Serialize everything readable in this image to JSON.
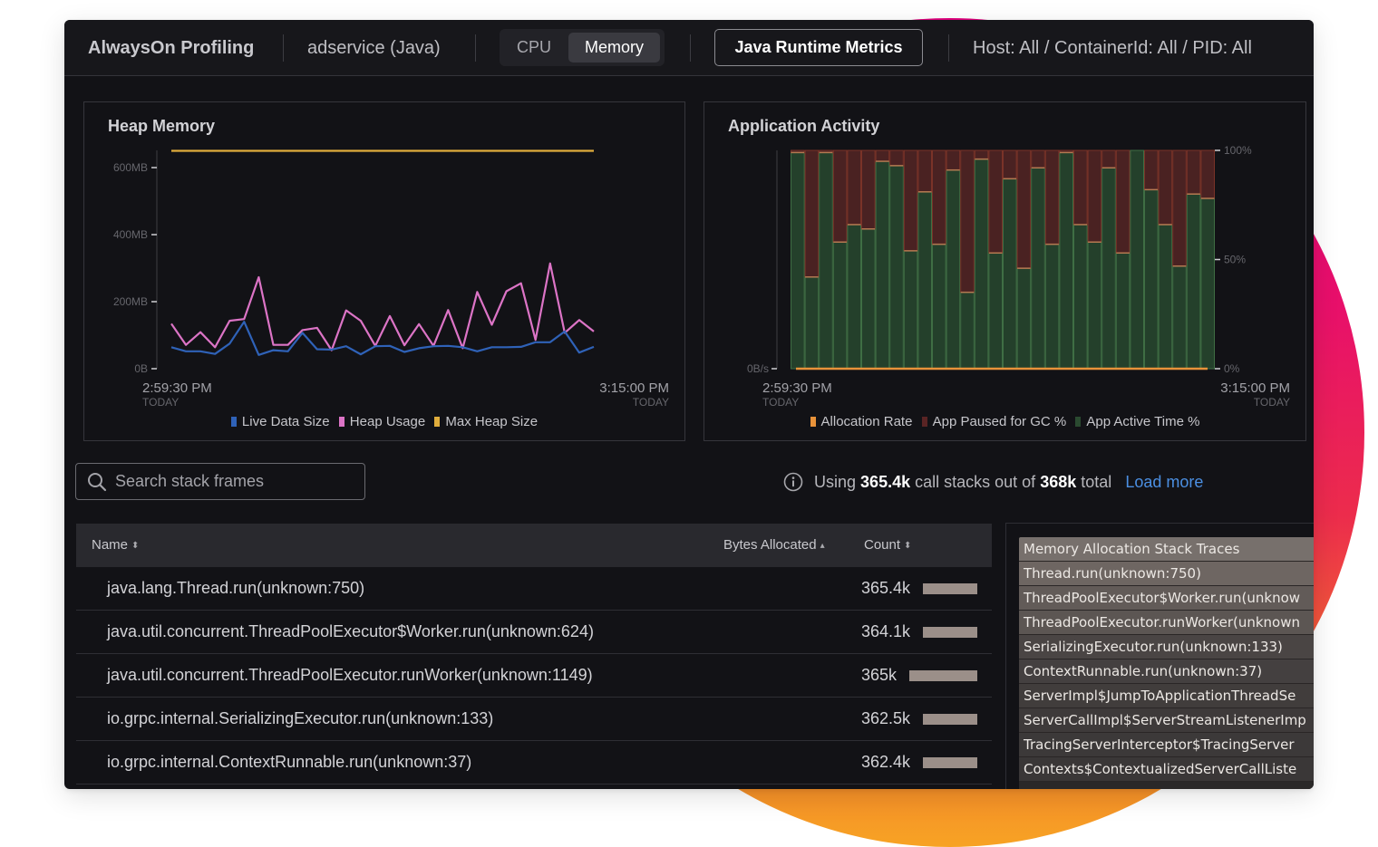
{
  "header": {
    "app_title": "AlwaysOn Profiling",
    "service": "adservice (Java)",
    "tabs": [
      {
        "label": "CPU",
        "active": false
      },
      {
        "label": "Memory",
        "active": true
      }
    ],
    "runtime_button": "Java Runtime Metrics",
    "filters": "Host: All / ContainerId: All / PID: All"
  },
  "heap_panel": {
    "title": "Heap Memory",
    "x_start": "2:59:30 PM",
    "x_start_sub": "TODAY",
    "x_end": "3:15:00 PM",
    "x_end_sub": "TODAY",
    "legend": [
      {
        "label": "Live Data Size",
        "color": "#2f62b8"
      },
      {
        "label": "Heap Usage",
        "color": "#dc74c6"
      },
      {
        "label": "Max Heap Size",
        "color": "#e0ad3c"
      }
    ]
  },
  "activity_panel": {
    "title": "Application Activity",
    "x_start": "2:59:30 PM",
    "x_start_sub": "TODAY",
    "x_end": "3:15:00 PM",
    "x_end_sub": "TODAY",
    "legend": [
      {
        "label": "Allocation Rate",
        "color": "#e8923a"
      },
      {
        "label": "App Paused for GC %",
        "color": "#5a2424"
      },
      {
        "label": "App Active Time %",
        "color": "#2a4a30"
      }
    ]
  },
  "chart_data": [
    {
      "type": "line",
      "title": "Heap Memory",
      "xlabel": "",
      "ylabel": "",
      "x_range": [
        "2:59:30 PM",
        "3:15:00 PM"
      ],
      "ylim": [
        0,
        650
      ],
      "y_unit": "MB",
      "yticks": [
        {
          "value": 0,
          "label": "0B"
        },
        {
          "value": 200,
          "label": "200MB"
        },
        {
          "value": 400,
          "label": "400MB"
        },
        {
          "value": 600,
          "label": "600MB"
        }
      ],
      "grid": false,
      "legend_position": "bottom",
      "series": [
        {
          "name": "Live Data Size",
          "color": "#2f62b8",
          "values": [
            64,
            52,
            52,
            44,
            75,
            140,
            41,
            55,
            52,
            107,
            58,
            57,
            67,
            43,
            67,
            68,
            50,
            61,
            67,
            68,
            64,
            52,
            64,
            64,
            65,
            79,
            79,
            111,
            48,
            65
          ]
        },
        {
          "name": "Heap Usage",
          "color": "#dc74c6",
          "values": [
            134,
            71,
            109,
            64,
            143,
            148,
            273,
            71,
            71,
            115,
            122,
            55,
            174,
            143,
            68,
            157,
            70,
            133,
            68,
            175,
            61,
            229,
            131,
            231,
            255,
            86,
            314,
            107,
            145,
            111
          ]
        },
        {
          "name": "Max Heap Size",
          "color": "#e0ad3c",
          "values": [
            650,
            650,
            650,
            650,
            650,
            650,
            650,
            650,
            650,
            650,
            650,
            650,
            650,
            650,
            650,
            650,
            650,
            650,
            650,
            650,
            650,
            650,
            650,
            650,
            650,
            650,
            650,
            650,
            650,
            650
          ]
        }
      ]
    },
    {
      "type": "bar",
      "stacked": true,
      "title": "Application Activity",
      "x_range": [
        "2:59:30 PM",
        "3:15:00 PM"
      ],
      "left_axis": {
        "ticks": [
          {
            "value": 0,
            "label": "0B/s"
          }
        ]
      },
      "right_axis": {
        "ylim": [
          0,
          100
        ],
        "ticks": [
          {
            "value": 0,
            "label": "0%"
          },
          {
            "value": 50,
            "label": "50%"
          },
          {
            "value": 100,
            "label": "100%"
          }
        ]
      },
      "grid": false,
      "legend_position": "bottom",
      "series": [
        {
          "name": "App Active Time %",
          "color": "#24402b",
          "values": [
            99,
            42,
            99,
            58,
            66,
            64,
            95,
            93,
            54,
            81,
            57,
            91,
            35,
            96,
            53,
            87,
            46,
            92,
            57,
            99,
            66,
            58,
            92,
            53,
            100,
            82,
            66,
            47,
            80,
            78
          ]
        },
        {
          "name": "App Paused for GC %",
          "color": "#4a2222",
          "values": [
            1,
            58,
            1,
            42,
            34,
            36,
            5,
            7,
            46,
            19,
            43,
            9,
            65,
            4,
            47,
            13,
            54,
            8,
            43,
            1,
            34,
            42,
            8,
            47,
            0,
            18,
            34,
            53,
            20,
            22
          ]
        },
        {
          "name": "Allocation Rate",
          "color": "#e8923a",
          "type": "line",
          "values": [
            0,
            0,
            0,
            0,
            0,
            0,
            0,
            0,
            0,
            0,
            0,
            0,
            0,
            0,
            0,
            0,
            0,
            0,
            0,
            0,
            0,
            0,
            0,
            0,
            0,
            0,
            0,
            0,
            0,
            0
          ]
        }
      ]
    }
  ],
  "search": {
    "placeholder": "Search stack frames",
    "value": ""
  },
  "info": {
    "prefix": "Using",
    "used": "365.4k",
    "middle": "call stacks out of",
    "total": "368k",
    "suffix": "total",
    "load_more": "Load more"
  },
  "table": {
    "columns": [
      {
        "label": "Name",
        "sort": "both"
      },
      {
        "label": "Bytes Allocated",
        "sort": "asc"
      },
      {
        "label": "Count",
        "sort": "both"
      }
    ],
    "rows": [
      {
        "name": "java.lang.Thread.run(unknown:750)",
        "count": "365.4k"
      },
      {
        "name": "java.util.concurrent.ThreadPoolExecutor$Worker.run(unknown:624)",
        "count": "364.1k"
      },
      {
        "name": "java.util.concurrent.ThreadPoolExecutor.runWorker(unknown:1149)",
        "count": "365k"
      },
      {
        "name": "io.grpc.internal.SerializingExecutor.run(unknown:133)",
        "count": "362.5k"
      },
      {
        "name": "io.grpc.internal.ContextRunnable.run(unknown:37)",
        "count": "362.4k"
      }
    ]
  },
  "stack_traces": {
    "items": [
      {
        "label": "Memory Allocation Stack Traces",
        "color": "#77706c"
      },
      {
        "label": "Thread.run(unknown:750)",
        "color": "#6e6662"
      },
      {
        "label": "ThreadPoolExecutor$Worker.run(unknow",
        "color": "#625b58"
      },
      {
        "label": "ThreadPoolExecutor.runWorker(unknown",
        "color": "#5c5653"
      },
      {
        "label": "SerializingExecutor.run(unknown:133)",
        "color": "#4a4544"
      },
      {
        "label": "ContextRunnable.run(unknown:37)",
        "color": "#444040"
      },
      {
        "label": "ServerImpl$JumpToApplicationThreadSe",
        "color": "#413d3c"
      },
      {
        "label": "ServerCallImpl$ServerStreamListenerImp",
        "color": "#3e3a3a"
      },
      {
        "label": "TracingServerInterceptor$TracingServer",
        "color": "#3c3939"
      },
      {
        "label": "Contexts$ContextualizedServerCallListe",
        "color": "#3a3737"
      }
    ]
  }
}
